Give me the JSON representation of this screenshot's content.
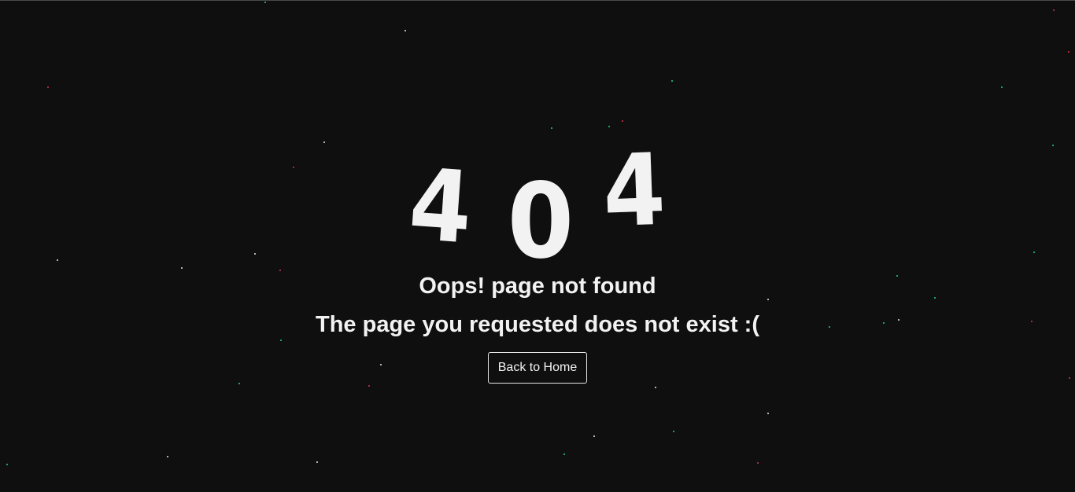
{
  "error": {
    "digits": [
      "4",
      "0",
      "4"
    ],
    "title": "Oops! page not found",
    "message": "The page you requested does not exist :("
  },
  "actions": {
    "back_home_label": "Back to Home"
  },
  "colors": {
    "background": "#0f0f10",
    "text": "#f2f2f2",
    "star_green": "#1fd38a",
    "star_red": "#d9334a",
    "star_white": "#e8e8e8"
  }
}
